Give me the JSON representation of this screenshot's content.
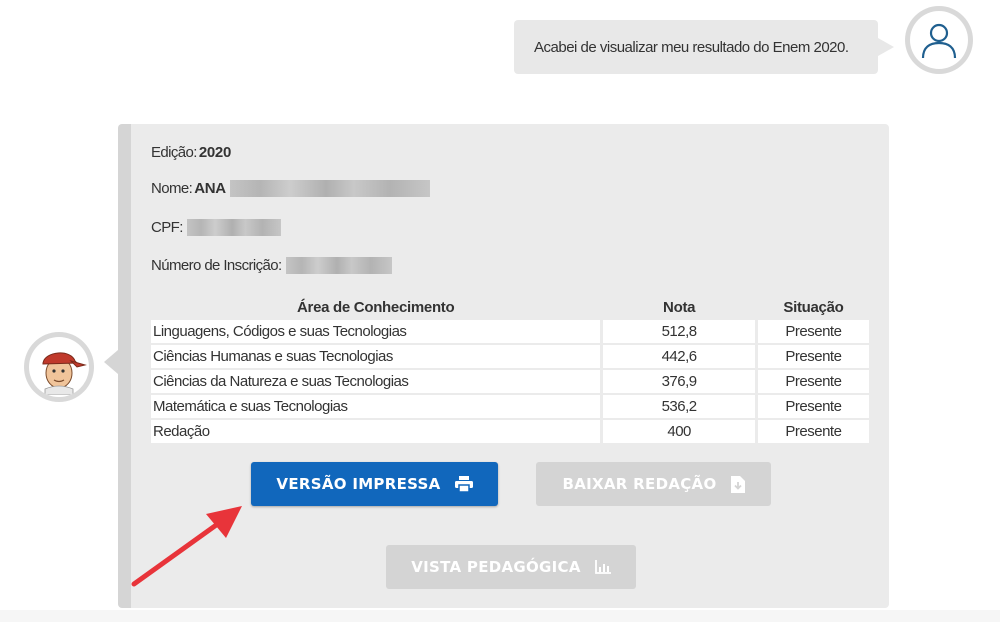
{
  "user_message": {
    "text": "Acabei de visualizar meu resultado do Enem 2020."
  },
  "result": {
    "edicao_label": "Edição:",
    "edicao_value": "2020",
    "nome_label": "Nome:",
    "nome_value": "ANA",
    "cpf_label": "CPF:",
    "inscricao_label": "Número de Inscrição:",
    "table": {
      "headers": {
        "area": "Área de Conhecimento",
        "nota": "Nota",
        "situacao": "Situação"
      },
      "rows": [
        {
          "area": "Linguagens, Códigos e suas Tecnologias",
          "nota": "512,8",
          "situacao": "Presente"
        },
        {
          "area": "Ciências Humanas e suas Tecnologias",
          "nota": "442,6",
          "situacao": "Presente"
        },
        {
          "area": "Ciências da Natureza e suas Tecnologias",
          "nota": "376,9",
          "situacao": "Presente"
        },
        {
          "area": "Matemática e suas Tecnologias",
          "nota": "536,2",
          "situacao": "Presente"
        },
        {
          "area": "Redação",
          "nota": "400",
          "situacao": "Presente"
        }
      ]
    },
    "buttons": {
      "versao_impressa": "VERSÃO IMPRESSA",
      "baixar_redacao": "BAIXAR REDAÇÃO",
      "vista_pedagogica": "VISTA PEDAGÓGICA"
    }
  },
  "icons": {
    "user_avatar": "user-outline-icon",
    "bot_avatar": "cartoon-character-avatar",
    "print": "printer-icon",
    "download": "file-download-icon",
    "chart": "bar-chart-icon",
    "annotation": "red-arrow"
  },
  "colors": {
    "primary_button": "#1167bc",
    "disabled_button": "#d4d4d4",
    "card_background": "#ebebeb",
    "annotation_arrow": "#e8343a"
  }
}
